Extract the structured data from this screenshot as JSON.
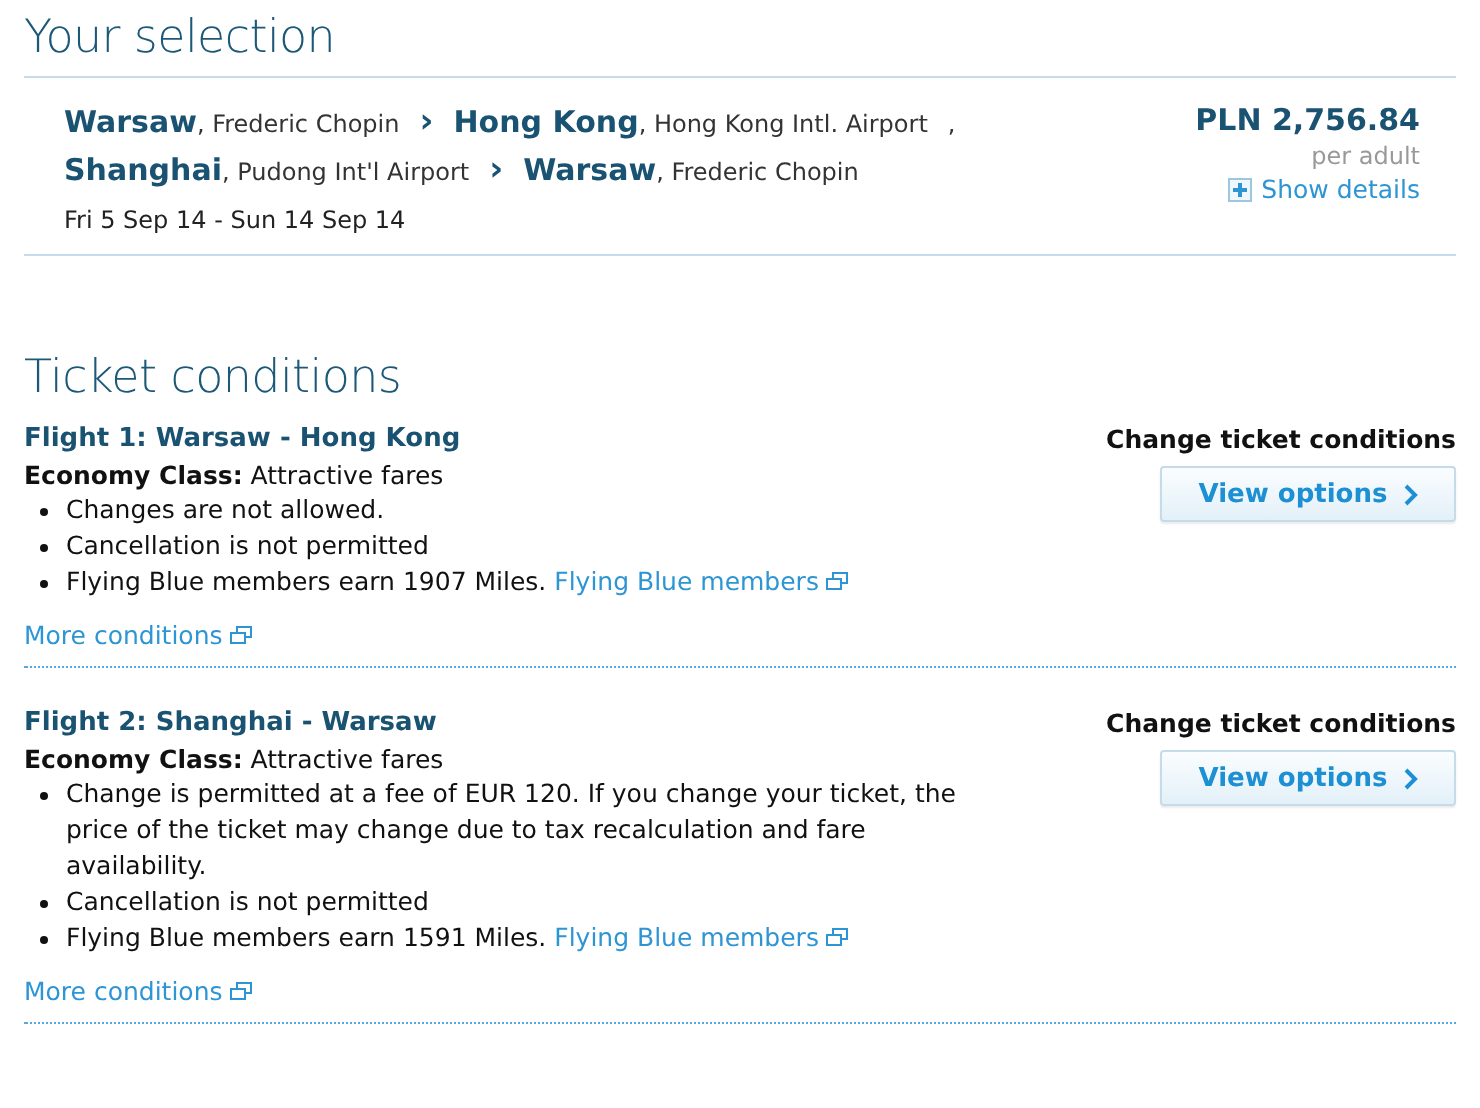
{
  "selection": {
    "heading": "Your selection",
    "legs": [
      {
        "from": {
          "city": "Warsaw",
          "airport": ", Frederic Chopin"
        },
        "arrow": "›",
        "to": {
          "city": "Hong Kong",
          "airport": ", Hong Kong Intl. Airport"
        },
        "trailing": ","
      },
      {
        "from": {
          "city": "Shanghai",
          "airport": ", Pudong Int'l Airport"
        },
        "arrow": "›",
        "to": {
          "city": "Warsaw",
          "airport": ", Frederic Chopin"
        }
      }
    ],
    "dates": "Fri 5 Sep 14 - Sun 14 Sep 14",
    "price": "PLN 2,756.84",
    "price_note": "per adult",
    "details_link": "Show details"
  },
  "conditions": {
    "heading": "Ticket conditions",
    "flights": [
      {
        "title": "Flight 1: Warsaw - Hong Kong",
        "fare": "**Economy Class:** Attractive fares",
        "items": [
          {
            "text": "Changes are not allowed."
          },
          {
            "text": "Cancellation is not permitted"
          },
          {
            "text": "Flying Blue members earn 1907 Miles.",
            "link": "Flying Blue members"
          }
        ],
        "more_link": "More conditions",
        "change_label": "Change ticket conditions",
        "button": "View options"
      },
      {
        "title": "Flight 2: Shanghai - Warsaw",
        "fare": "**Economy Class:** Attractive fares",
        "items": [
          {
            "text": "Change is permitted at a fee of EUR 120. If you change your ticket, the price of the ticket may change due to tax recalculation and fare availability."
          },
          {
            "text": "Cancellation is not permitted"
          },
          {
            "text": "Flying Blue members earn 1591 Miles.",
            "link": "Flying Blue members"
          }
        ],
        "more_link": "More conditions",
        "change_label": "Change ticket conditions",
        "button": "View options"
      }
    ]
  }
}
